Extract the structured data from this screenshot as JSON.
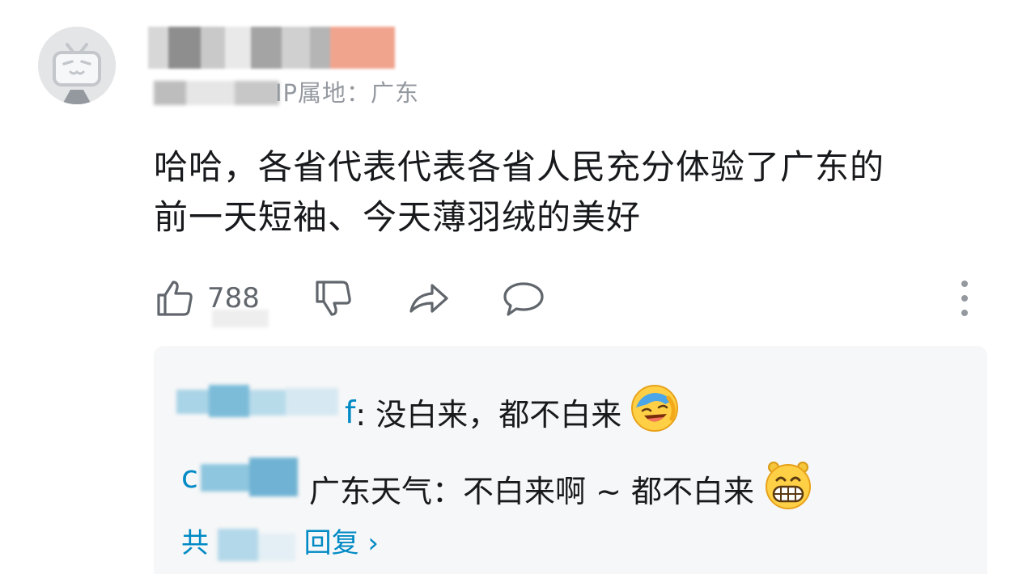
{
  "comment": {
    "ip_location": "IP属地：广东",
    "text": "哈哈，各省代表代表各省人民充分体验了广东的\n前一天短袖、今天薄羽绒的美好",
    "like_count": "788"
  },
  "icons": {
    "avatar": "bilibili-tv-avatar",
    "like": "thumbs-up-icon",
    "dislike": "thumbs-down-icon",
    "share": "share-arrow-icon",
    "reply": "speech-bubble-icon",
    "more": "vertical-dots-icon",
    "emoji_1": "laughing-tears-emoji",
    "emoji_2": "grinning-emoji"
  },
  "replies": [
    {
      "user_suffix": "f",
      "text": ": 没白来，都不白来"
    },
    {
      "user_prefix": "c",
      "user_suffix": "广东天气",
      "text": "：不白来啊 ~ 都不白来"
    }
  ],
  "more_replies": {
    "prefix": "共",
    "label": "回复 ›"
  },
  "colors": {
    "link": "#008ac5",
    "meta": "#9499a0",
    "text": "#18191c",
    "reply_bg": "#f6f7f8"
  }
}
